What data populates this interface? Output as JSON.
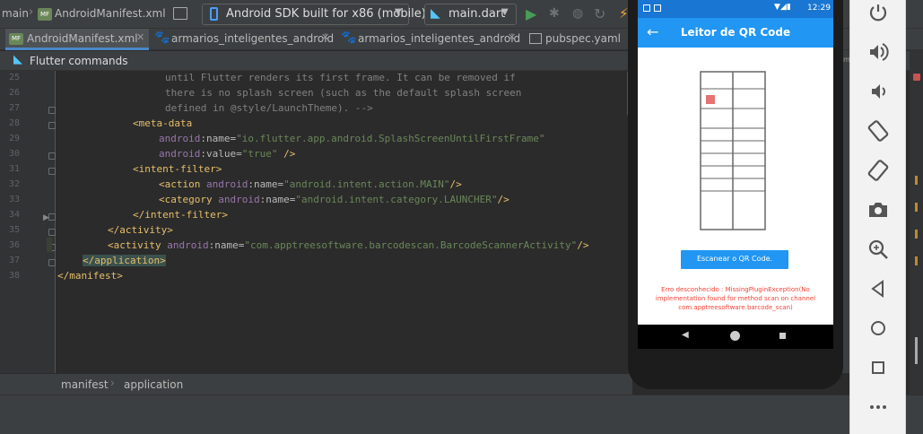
{
  "toolbar": {
    "branch": "main",
    "file": "AndroidManifest.xml",
    "device": "Android SDK built for x86 (mobile)",
    "run_config": "main.dart"
  },
  "tabs": [
    {
      "label": "AndroidManifest.xml"
    },
    {
      "label": "armarios_inteligentes_android"
    },
    {
      "label": "armarios_inteligentes_android"
    },
    {
      "label": "pubspec.yaml"
    }
  ],
  "flutter_commands": "Flutter commands",
  "line_numbers": [
    "25",
    "26",
    "27",
    "28",
    "29",
    "30",
    "31",
    "32",
    "33",
    "34",
    "35",
    "36",
    "37",
    "38"
  ],
  "code": {
    "l25": "until Flutter renders its first frame. It can be removed if",
    "l26": "there is no splash screen (such as the default splash screen",
    "l27": "defined in @style/LaunchTheme). -->",
    "l28_tag": "<meta-data",
    "l29_ns": "android",
    "l29_attr": ":name=",
    "l29_val": "\"io.flutter.app.android.SplashScreenUntilFirstFrame\"",
    "l30_ns": "android",
    "l30_attr": ":value=",
    "l30_val": "\"true\"",
    "l30_end": " />",
    "l31_tag": "<intent-filter>",
    "l32_tag": "<action ",
    "l32_ns": "android",
    "l32_attr": ":name=",
    "l32_val": "\"android.intent.action.MAIN\"",
    "l32_end": "/>",
    "l33_tag": "<category ",
    "l33_ns": "android",
    "l33_attr": ":name=",
    "l33_val": "\"android.intent.category.LAUNCHER\"",
    "l33_end": "/>",
    "l34_tag": "</intent-filter>",
    "l35_tag": "</activity>",
    "l36_tag": "<activity ",
    "l36_ns": "android",
    "l36_attr": ":name=",
    "l36_val": "\"com.apptreesoftware.barcodescan.BarcodeScannerActivity\"",
    "l36_end": "/>",
    "l37_tag": "</application>",
    "l38_tag": "</manifest>"
  },
  "breadcrumb": [
    "manifest",
    "application"
  ],
  "phone": {
    "time": "12:29",
    "title": "Leitor de QR Code",
    "button": "Escanear o QR Code.",
    "error": [
      "Erro desconhecido : MissingPluginException(No",
      "implementation found for method scan on channel",
      "com.apptreesoftware.barcode_scan)"
    ]
  },
  "colors": {
    "accent": "#2196f3",
    "error": "#f44336"
  }
}
